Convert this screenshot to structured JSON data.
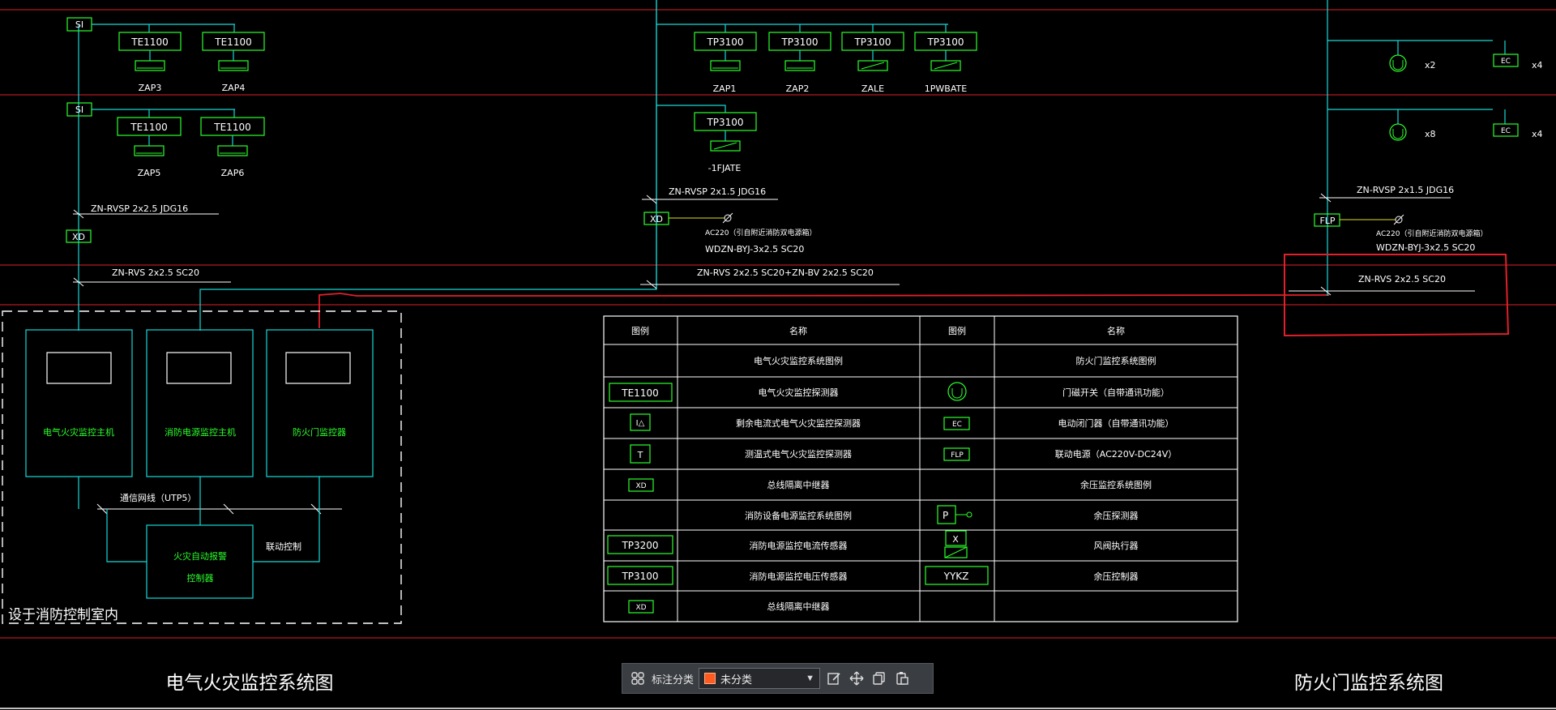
{
  "diagram": {
    "left_system": {
      "rows": [
        {
          "module": "SI",
          "devices": [
            {
              "model": "TE1100",
              "label": "ZAP3"
            },
            {
              "model": "TE1100",
              "label": "ZAP4"
            }
          ]
        },
        {
          "module": "SI",
          "devices": [
            {
              "model": "TE1100",
              "label": "ZAP5"
            },
            {
              "model": "TE1100",
              "label": "ZAP6"
            }
          ]
        }
      ],
      "cable_1": "ZN-RVSP 2x2.5  JDG16",
      "isolator": "XD",
      "cable_2": "ZN-RVS 2x2.5  SC20",
      "panels": [
        "电气火灾监控主机",
        "消防电源监控主机",
        "防火门监控器"
      ],
      "network_label": "通信网线（UTP5）",
      "fire_controller": "火灾自动报警\n控制器",
      "fire_controller_line1": "火灾自动报警",
      "fire_controller_line2": "控制器",
      "linkage_label": "联动控制",
      "room_label": "设于消防控制室内",
      "title": "电气火灾监控系统图"
    },
    "middle_system": {
      "row1": [
        {
          "model": "TP3100",
          "label": "ZAP1"
        },
        {
          "model": "TP3100",
          "label": "ZAP2"
        },
        {
          "model": "TP3100",
          "label": "ZALE"
        },
        {
          "model": "TP3100",
          "label": "1PWBATE"
        }
      ],
      "row2": [
        {
          "model": "TP3100",
          "label": "-1FJATE"
        }
      ],
      "cable_1": "ZN-RVSP 2x1.5  JDG16",
      "isolator": "XD",
      "power_1": "AC220（引自附近消防双电源箱）",
      "power_2": "WDZN-BYJ-3x2.5  SC20",
      "cable_2": "ZN-RVS 2x2.5  SC20+ZN-BV 2x2.5  SC20"
    },
    "right_system": {
      "rows": [
        {
          "count": "x2",
          "ec": "EC",
          "ec_count": "x4"
        },
        {
          "count": "x8",
          "ec": "EC",
          "ec_count": "x4"
        }
      ],
      "cable_1": "ZN-RVSP 2x1.5  JDG16",
      "power_module": "FLP",
      "power_1": "AC220（引自附近消防双电源箱）",
      "power_2": "WDZN-BYJ-3x2.5  SC20",
      "cable_2": "ZN-RVS 2x2.5  SC20",
      "title": "防火门监控系统图"
    },
    "legend": {
      "headers": [
        "图例",
        "名称",
        "图例",
        "名称"
      ],
      "rows": [
        {
          "sym1": "",
          "name1": "电气火灾监控系统图例",
          "sym2": "",
          "name2": "防火门监控系统图例"
        },
        {
          "sym1": "TE1100",
          "name1": "电气火灾监控探测器",
          "sym2": "",
          "name2": "门磁开关（自带通讯功能）"
        },
        {
          "sym1": "I△",
          "name1": "剩余电流式电气火灾监控探测器",
          "sym2": "EC",
          "name2": "电动闭门器（自带通讯功能）"
        },
        {
          "sym1": "T",
          "name1": "测温式电气火灾监控探测器",
          "sym2": "FLP",
          "name2": "联动电源（AC220V-DC24V）"
        },
        {
          "sym1": "XD",
          "name1": "总线隔离中继器",
          "sym2": "",
          "name2": "余压监控系统图例"
        },
        {
          "sym1": "",
          "name1": "消防设备电源监控系统图例",
          "sym2": "P",
          "name2": "余压探测器"
        },
        {
          "sym1": "TP3200",
          "name1": "消防电源监控电流传感器",
          "sym2": "X",
          "name2": "风阀执行器"
        },
        {
          "sym1": "TP3100",
          "name1": "消防电源监控电压传感器",
          "sym2": "YYKZ",
          "name2": "余压控制器"
        },
        {
          "sym1": "XD",
          "name1": "总线隔离中继器",
          "sym2": "",
          "name2": ""
        }
      ]
    }
  },
  "toolbar": {
    "grid_icon": "grid-icon",
    "label": "标注分类",
    "category": "未分类",
    "category_color": "#ff5a1f",
    "icons": [
      "edit-icon",
      "move-icon",
      "copy-icon",
      "paste-icon"
    ]
  },
  "colors": {
    "background": "#000000",
    "device": "#2bff2b",
    "wire": "#18d8d8",
    "frame": "#e0202a"
  }
}
